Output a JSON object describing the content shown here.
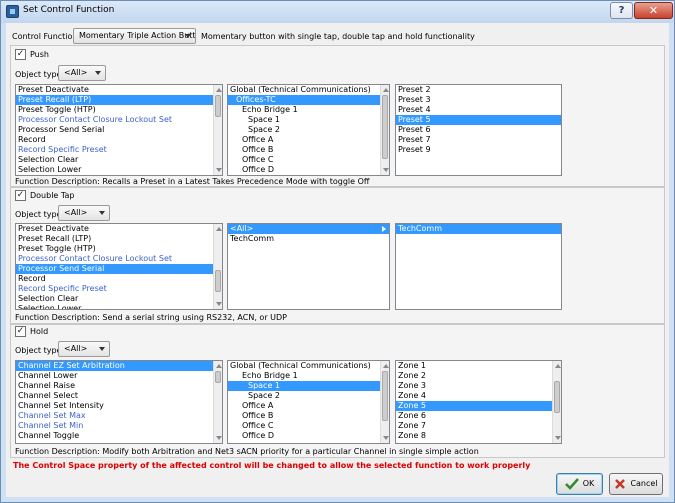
{
  "window": {
    "title": "Set Control Function",
    "help_glyph": "?",
    "close_glyph": "✕"
  },
  "control_function": {
    "label": "Control Function:",
    "value": "Momentary Triple Action Button",
    "description": "Momentary button with single tap, double tap and hold functionality"
  },
  "sections": [
    {
      "checkbox_label": "Push",
      "checked": true,
      "object_type_label": "Object type",
      "object_type_value": "<All>",
      "functions": [
        {
          "label": "Preset Deactivate",
          "blue": false,
          "selected": false
        },
        {
          "label": "Preset Recall (LTP)",
          "blue": false,
          "selected": true
        },
        {
          "label": "Preset Toggle (HTP)",
          "blue": false,
          "selected": false
        },
        {
          "label": "Processor Contact Closure Lockout Set",
          "blue": true,
          "selected": false
        },
        {
          "label": "Processor Send Serial",
          "blue": false,
          "selected": false
        },
        {
          "label": "Record",
          "blue": false,
          "selected": false
        },
        {
          "label": "Record Specific Preset",
          "blue": true,
          "selected": false
        },
        {
          "label": "Selection Clear",
          "blue": false,
          "selected": false
        },
        {
          "label": "Selection Lower",
          "blue": false,
          "selected": false
        }
      ],
      "locations": [
        {
          "label": "Global (Technical Communications)",
          "indent": 0,
          "selected": false,
          "arrow": true
        },
        {
          "label": "Offices-TC",
          "indent": 1,
          "selected": true,
          "arrow": true
        },
        {
          "label": "Echo Bridge 1",
          "indent": 2,
          "selected": false,
          "arrow": false
        },
        {
          "label": "Space 1",
          "indent": 3,
          "selected": false,
          "arrow": false
        },
        {
          "label": "Space 2",
          "indent": 3,
          "selected": false,
          "arrow": false
        },
        {
          "label": "Office A",
          "indent": 2,
          "selected": false,
          "arrow": false
        },
        {
          "label": "Office B",
          "indent": 2,
          "selected": false,
          "arrow": false
        },
        {
          "label": "Office C",
          "indent": 2,
          "selected": false,
          "arrow": false
        },
        {
          "label": "Office D",
          "indent": 2,
          "selected": false,
          "arrow": false
        }
      ],
      "targets": [
        {
          "label": "Preset 2",
          "selected": false
        },
        {
          "label": "Preset 3",
          "selected": false
        },
        {
          "label": "Preset 4",
          "selected": false
        },
        {
          "label": "Preset 5",
          "selected": true
        },
        {
          "label": "Preset 6",
          "selected": false
        },
        {
          "label": "Preset 7",
          "selected": false
        },
        {
          "label": "Preset 9",
          "selected": false
        }
      ],
      "description": "Function Description: Recalls a Preset in a Latest Takes Precedence Mode with toggle Off"
    },
    {
      "checkbox_label": "Double Tap",
      "checked": true,
      "object_type_label": "Object type",
      "object_type_value": "<All>",
      "functions": [
        {
          "label": "Preset Deactivate",
          "blue": false,
          "selected": false
        },
        {
          "label": "Preset Recall (LTP)",
          "blue": false,
          "selected": false
        },
        {
          "label": "Preset Toggle (HTP)",
          "blue": false,
          "selected": false
        },
        {
          "label": "Processor Contact Closure Lockout Set",
          "blue": true,
          "selected": false
        },
        {
          "label": "Processor Send Serial",
          "blue": false,
          "selected": true
        },
        {
          "label": "Record",
          "blue": false,
          "selected": false
        },
        {
          "label": "Record Specific Preset",
          "blue": true,
          "selected": false
        },
        {
          "label": "Selection Clear",
          "blue": false,
          "selected": false
        },
        {
          "label": "Selection Lower",
          "blue": false,
          "selected": false
        }
      ],
      "locations": [
        {
          "label": "<All>",
          "indent": 0,
          "selected": true,
          "arrow": true
        },
        {
          "label": "TechComm",
          "indent": 0,
          "selected": false,
          "arrow": false
        }
      ],
      "targets": [
        {
          "label": "TechComm",
          "selected": true
        }
      ],
      "description": "Function Description: Send a serial string using RS232, ACN, or UDP"
    },
    {
      "checkbox_label": "Hold",
      "checked": true,
      "object_type_label": "Object type",
      "object_type_value": "<All>",
      "functions": [
        {
          "label": "Channel EZ Set Arbitration",
          "blue": false,
          "selected": true
        },
        {
          "label": "Channel Lower",
          "blue": false,
          "selected": false
        },
        {
          "label": "Channel Raise",
          "blue": false,
          "selected": false
        },
        {
          "label": "Channel Select",
          "blue": false,
          "selected": false
        },
        {
          "label": "Channel Set Intensity",
          "blue": false,
          "selected": false
        },
        {
          "label": "Channel Set Max",
          "blue": true,
          "selected": false
        },
        {
          "label": "Channel Set Min",
          "blue": true,
          "selected": false
        },
        {
          "label": "Channel Toggle",
          "blue": false,
          "selected": false
        }
      ],
      "locations": [
        {
          "label": "Global (Technical Communications)",
          "indent": 0,
          "selected": false,
          "arrow": true
        },
        {
          "label": "Echo Bridge 1",
          "indent": 2,
          "selected": false,
          "arrow": false
        },
        {
          "label": "Space 1",
          "indent": 3,
          "selected": true,
          "arrow": true
        },
        {
          "label": "Space 2",
          "indent": 3,
          "selected": false,
          "arrow": false
        },
        {
          "label": "Office A",
          "indent": 2,
          "selected": false,
          "arrow": false
        },
        {
          "label": "Office B",
          "indent": 2,
          "selected": false,
          "arrow": false
        },
        {
          "label": "Office C",
          "indent": 2,
          "selected": false,
          "arrow": false
        },
        {
          "label": "Office D",
          "indent": 2,
          "selected": false,
          "arrow": false
        }
      ],
      "targets": [
        {
          "label": "Zone 1",
          "selected": false
        },
        {
          "label": "Zone 2",
          "selected": false
        },
        {
          "label": "Zone 3",
          "selected": false
        },
        {
          "label": "Zone 4",
          "selected": false
        },
        {
          "label": "Zone 5",
          "selected": true
        },
        {
          "label": "Zone 6",
          "selected": false
        },
        {
          "label": "Zone 7",
          "selected": false
        },
        {
          "label": "Zone 8",
          "selected": false
        }
      ],
      "description": "Function Description: Modify both Arbitration and Net3 sACN priority for a particular Channel in single simple action"
    }
  ],
  "warning": "The Control Space property of the affected control will be changed to allow the selected function to work properly",
  "buttons": {
    "ok": "OK",
    "cancel": "Cancel"
  }
}
